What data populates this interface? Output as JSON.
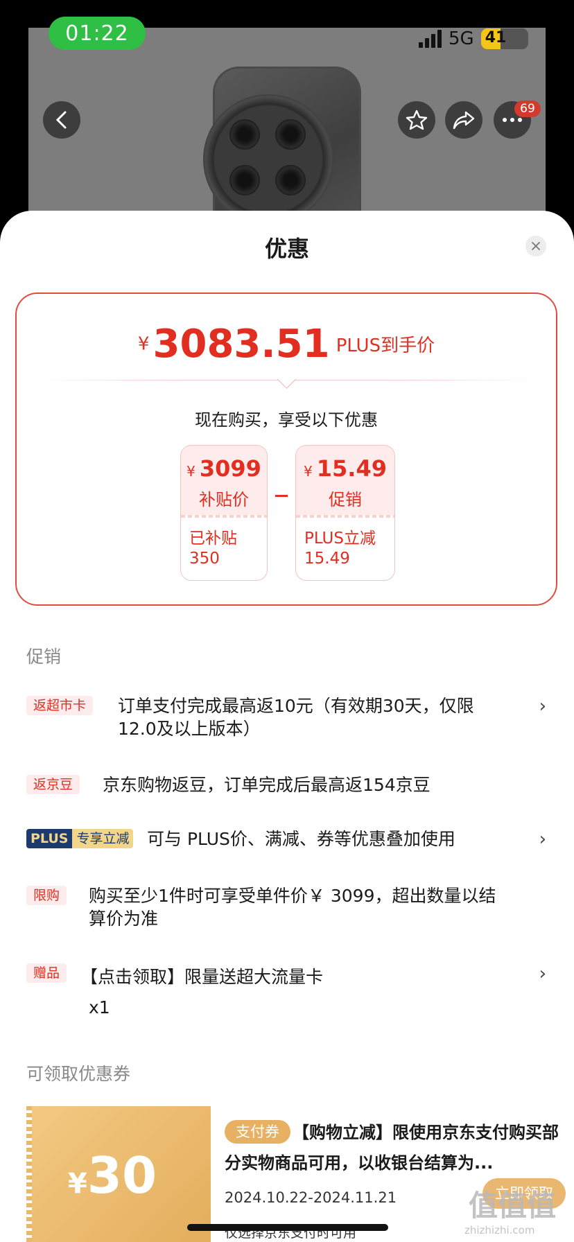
{
  "status_bar": {
    "time": "01:22",
    "network": "5G",
    "battery": "41",
    "battery_level": 0.41
  },
  "header": {
    "more_badge": "69"
  },
  "sheet": {
    "title": "优惠"
  },
  "summary": {
    "currency": "¥",
    "final_price": "3083.51",
    "final_label": "PLUS到手价",
    "now_buy_text": "现在购买，享受以下优惠",
    "items": [
      {
        "currency": "¥",
        "value": "3099",
        "label": "补贴价",
        "detail_line1": "已补贴",
        "detail_line2": "350"
      },
      {
        "currency": "¥",
        "value": "15.49",
        "label": "促销",
        "detail_line1": "PLUS立减",
        "detail_line2": "15.49"
      }
    ]
  },
  "promotions": {
    "heading": "促销",
    "rows": [
      {
        "tag": "返超市卡",
        "text": "订单支付完成最高返10元（有效期30天，仅限",
        "text2": "12.0及以上版本）"
      },
      {
        "tag": "返京豆",
        "text": "京东购物返豆，订单完成后最高返154京豆"
      },
      {
        "tag_a": "PLUS",
        "tag_b": "专享立减",
        "text": "可与 PLUS价、满减、券等优惠叠加使用"
      },
      {
        "tag": "限购",
        "text": "购买至少1件时可享受单件价￥ 3099，超出数量以结",
        "text2": "算价为准"
      },
      {
        "tag": "赠品",
        "text": "【点击领取】限量送超大流量卡",
        "text2": "x1"
      }
    ],
    "chevron": "›"
  },
  "coupons": {
    "heading": "可领取优惠券",
    "item": {
      "currency": "¥",
      "amount": "30",
      "tag": "支付券",
      "title": "【购物立减】限使用京东支付购买部分实物商品可用，以收银台结算为...",
      "date": "2024.10.22-2024.11.21",
      "note": "仅选择京东支付时可用",
      "button": "立即领取"
    }
  },
  "watermark": {
    "text": "值值值",
    "sub": "zhizhizhi.com"
  },
  "colors": {
    "accent_red": "#e12e20",
    "coupon_gold": "#e8b062",
    "plus_navy": "#1d3a6e"
  }
}
